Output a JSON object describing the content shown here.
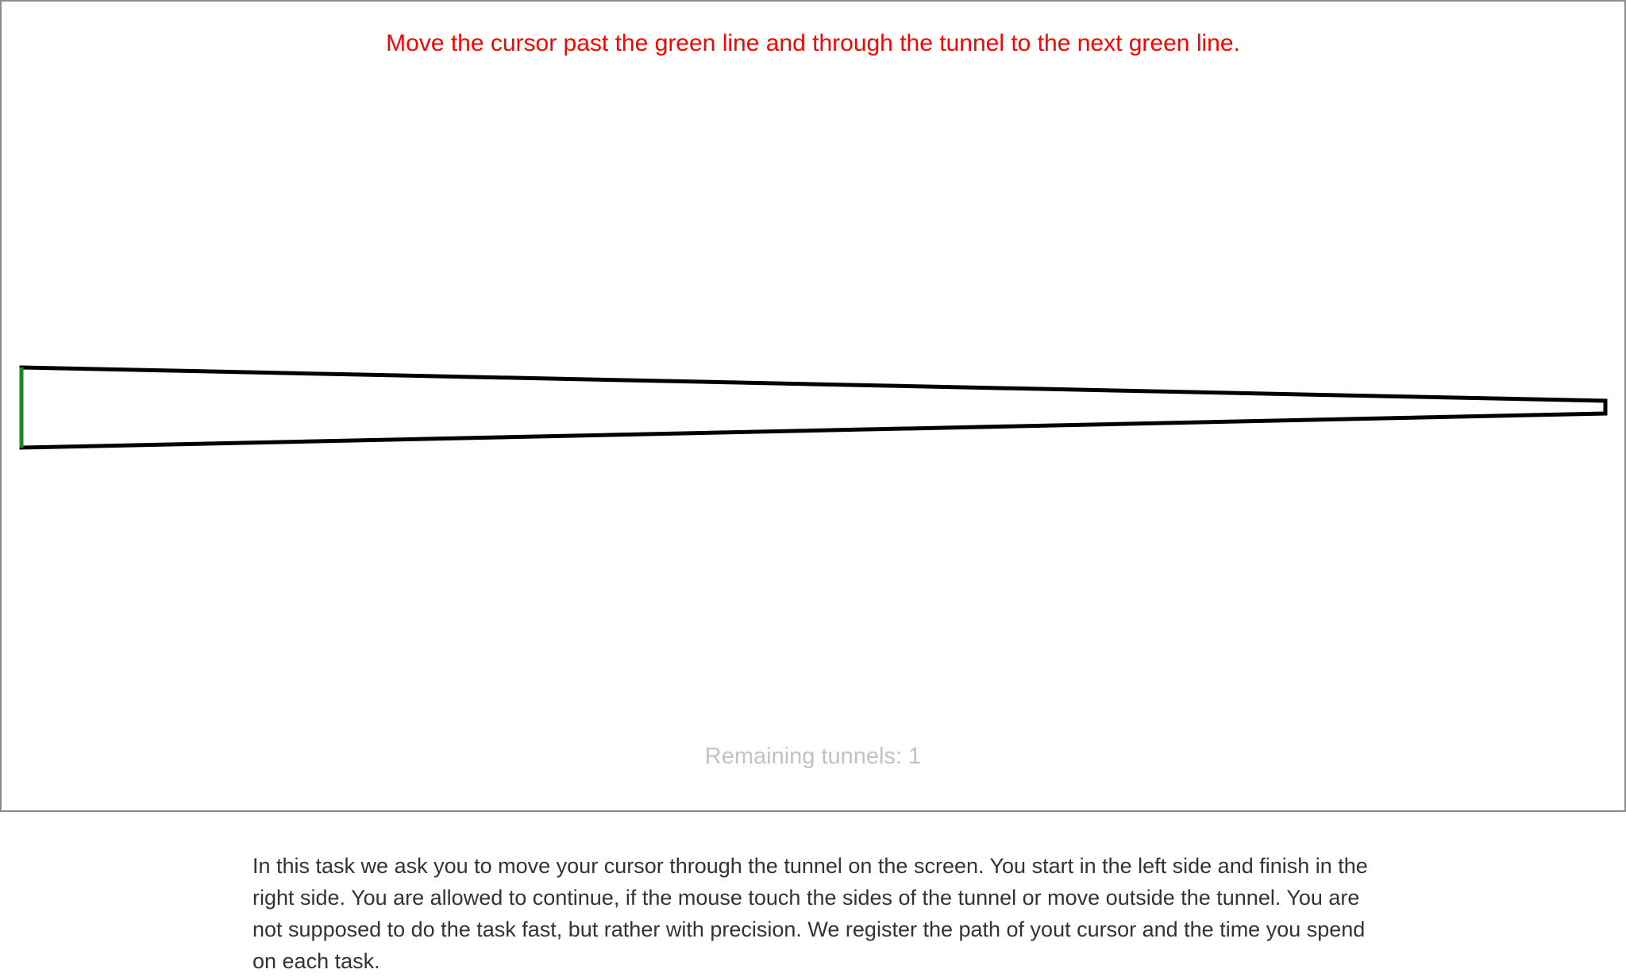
{
  "task": {
    "instruction": "Move the cursor past the green line and through the tunnel to the next green line.",
    "remaining_text": "Remaining tunnels: 1",
    "description": "In this task we ask you to move your cursor through the tunnel on the screen. You start in the left side and finish in the right side. You are allowed to continue, if the mouse touch the sides of the tunnel or move outside the tunnel. You are not supposed to do the task fast, but rather with precision. We register the path of yout cursor and the time you spend on each task."
  },
  "colors": {
    "instruction": "#ff0000",
    "remaining": "#c2c2c2",
    "tunnel_outline": "#000000",
    "start_line": "#1a8a1a",
    "panel_border": "#8c8c8c"
  }
}
